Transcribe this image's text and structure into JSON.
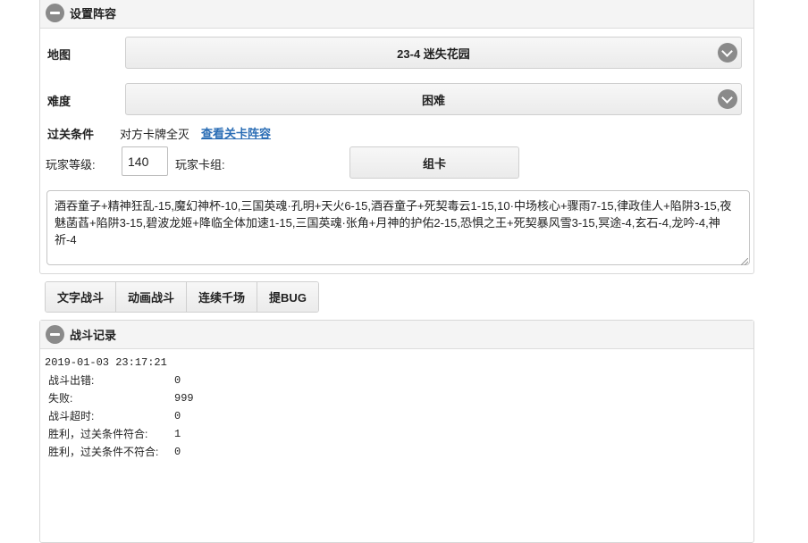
{
  "setup": {
    "title": "设置阵容",
    "map_label": "地图",
    "map_value": "23-4 迷失花园",
    "difficulty_label": "难度",
    "difficulty_value": "困难",
    "condition_label": "过关条件",
    "condition_value": "对方卡牌全灭",
    "condition_link": "查看关卡阵容",
    "level_label": "玩家等级:",
    "level_value": "140",
    "deck_label": "玩家卡组:",
    "deck_button": "组卡",
    "lineup_text": "酒吞童子+精神狂乱-15,魔幻神杯-10,三国英魂·孔明+天火6-15,酒吞童子+死契毒云1-15,10·中场核心+骤雨7-15,律政佳人+陷阱3-15,夜魅菡萏+陷阱3-15,碧波龙姬+降临全体加速1-15,三国英魂·张角+月神的护佑2-15,恐惧之王+死契暴风雪3-15,冥途-4,玄石-4,龙吟-4,神祈-4"
  },
  "actions": {
    "text_battle": "文字战斗",
    "animated_battle": "动画战斗",
    "continuous": "连续千场",
    "report_bug": "提BUG"
  },
  "log": {
    "title": "战斗记录",
    "timestamp": "2019-01-03 23:17:21",
    "rows": [
      {
        "key": "战斗出错:",
        "value": "0"
      },
      {
        "key": "失败:",
        "value": "999"
      },
      {
        "key": "战斗超时:",
        "value": "0"
      },
      {
        "key": "胜利，过关条件符合:",
        "value": "1"
      },
      {
        "key": "胜利，过关条件不符合:",
        "value": "0"
      }
    ]
  },
  "colors": {
    "link": "#2a6db5",
    "icon": "#8a8a8a"
  },
  "icons": {
    "collapse": "minus-circle-icon",
    "dropdown": "chevron-down-circle-icon"
  }
}
